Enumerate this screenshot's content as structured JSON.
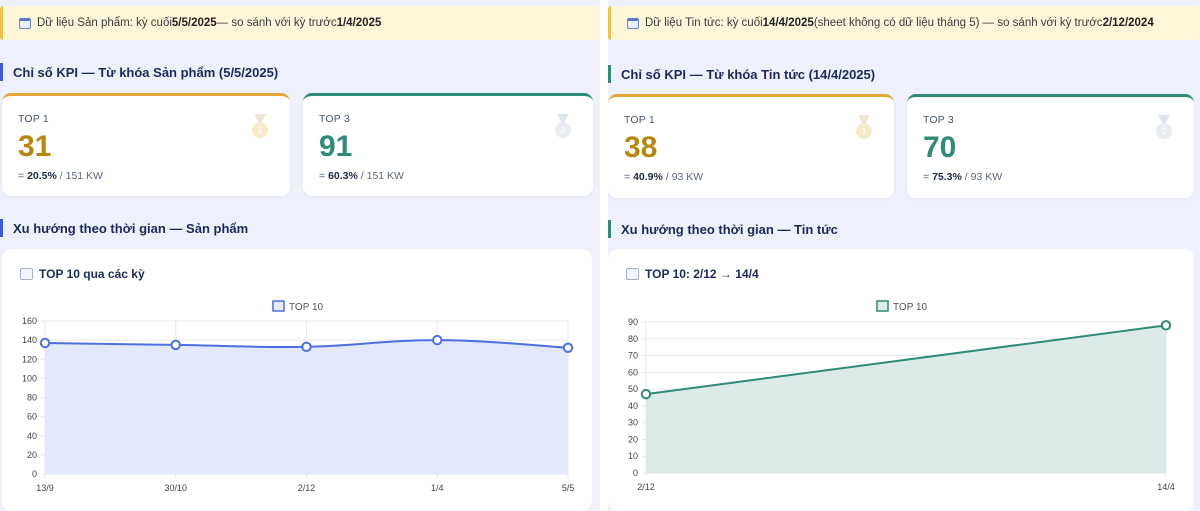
{
  "left": {
    "banner": {
      "prefix": "Dữ liệu Sản phẩm: kỳ cuối ",
      "last": "5/5/2025",
      "middle": " — so sánh với kỳ trước ",
      "prev": "1/4/2025",
      "suffix": ""
    },
    "kpi_title": "Chỉ số KPI — Từ khóa Sản phẩm (5/5/2025)",
    "kpis": [
      {
        "label": "TOP 1",
        "value": "31",
        "pct": "20.5%",
        "eq": "=",
        "total": "/ 151 KW",
        "icon": "gold-medal-icon"
      },
      {
        "label": "TOP 3",
        "value": "91",
        "pct": "60.3%",
        "eq": "=",
        "total": "/ 151 KW",
        "icon": "silver-medal-icon"
      }
    ],
    "trend_title": "Xu hướng theo thời gian — Sản phẩm",
    "chart_card_title": "TOP 10 qua các kỳ"
  },
  "right": {
    "banner": {
      "prefix": "Dữ liệu Tin tức: kỳ cuối ",
      "last": "14/4/2025",
      "middle": " (sheet không có dữ liệu tháng 5) — so sánh với kỳ trước ",
      "prev": "2/12/2024",
      "suffix": ""
    },
    "kpi_title": "Chỉ số KPI — Từ khóa Tin tức (14/4/2025)",
    "kpis": [
      {
        "label": "TOP 1",
        "value": "38",
        "pct": "40.9%",
        "eq": "=",
        "total": "/ 93 KW",
        "icon": "gold-medal-icon"
      },
      {
        "label": "TOP 3",
        "value": "70",
        "pct": "75.3%",
        "eq": "=",
        "total": "/ 93 KW",
        "icon": "silver-medal-icon"
      }
    ],
    "trend_title": "Xu hướng theo thời gian — Tin tức",
    "chart_card_title": "TOP 10: 2/12 → 14/4"
  },
  "chart_data": [
    {
      "type": "area",
      "categories": [
        "13/9",
        "30/10",
        "2/12",
        "1/4",
        "5/5"
      ],
      "series": [
        {
          "name": "TOP 10",
          "values": [
            137,
            135,
            133,
            140,
            132
          ]
        }
      ],
      "ylim": [
        0,
        160
      ],
      "yticks": [
        0,
        20,
        40,
        60,
        80,
        100,
        120,
        140,
        160
      ],
      "color": "#4e6fe0",
      "fill": "#e3e8fb",
      "legend": "top-center",
      "grid": true
    },
    {
      "type": "area",
      "categories": [
        "2/12",
        "14/4"
      ],
      "series": [
        {
          "name": "TOP 10",
          "values": [
            47,
            88
          ]
        }
      ],
      "ylim": [
        0,
        90
      ],
      "yticks": [
        0,
        10,
        20,
        30,
        40,
        50,
        60,
        70,
        80,
        90
      ],
      "color": "#2e8b77",
      "fill": "#dcebe7",
      "legend": "top-center",
      "grid": true
    }
  ]
}
